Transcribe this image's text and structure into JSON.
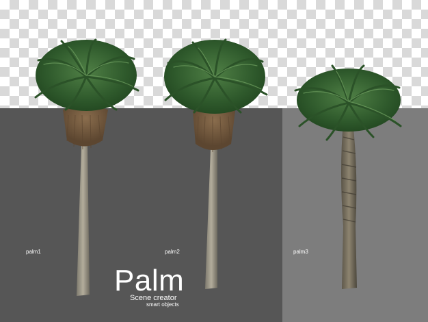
{
  "labels": {
    "palm1": "palm1",
    "palm2": "palm2",
    "palm3": "palm3"
  },
  "brand": {
    "title": "Palm",
    "subtitle": "Scene creator",
    "tagline": "smart objects"
  },
  "colors": {
    "dark_panel": "#565656",
    "light_panel": "#7d7d7d",
    "checker_gray": "#d9d9d9",
    "trunk": "#9a9484",
    "foliage": "#3d6b3a"
  }
}
